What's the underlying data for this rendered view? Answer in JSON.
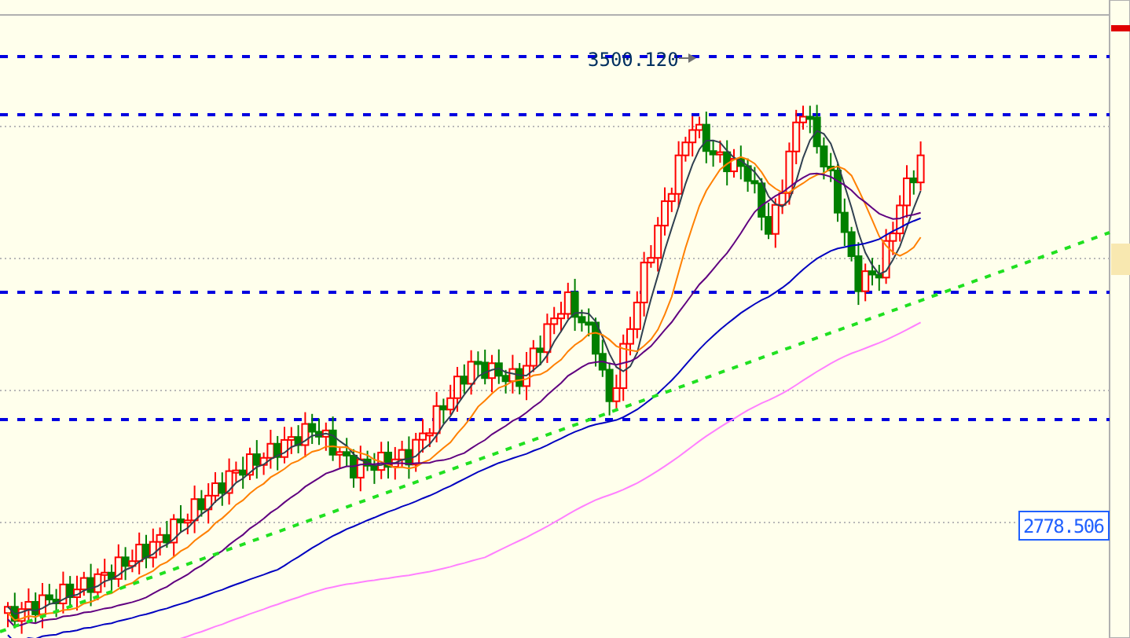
{
  "chart": {
    "high_label": "3500.120",
    "price_label": "2778.506"
  }
}
